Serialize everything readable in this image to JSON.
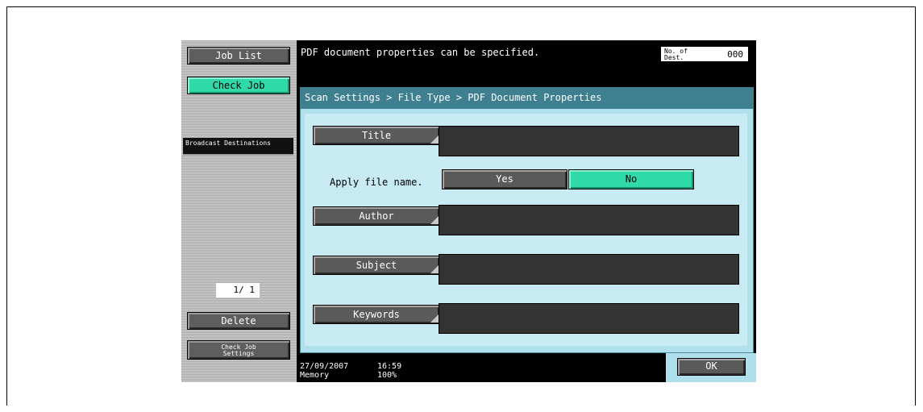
{
  "left_panel": {
    "job_list_label": "Job List",
    "check_job_label": "Check Job",
    "broadcast_label": "Broadcast Destinations",
    "page_count": "1/ 1",
    "delete_label": "Delete",
    "check_job_settings_label": "Check Job Settings"
  },
  "header": {
    "message": "PDF document properties can be specified.",
    "dest_label": "No. of Dest.",
    "dest_value": "000"
  },
  "dialog": {
    "breadcrumb": "Scan Settings > File Type > PDF Document Properties",
    "title_label": "Title",
    "apply_label": "Apply file name.",
    "yes_label": "Yes",
    "no_label": "No",
    "author_label": "Author",
    "subject_label": "Subject",
    "keywords_label": "Keywords",
    "ok_label": "OK"
  },
  "status": {
    "date": "27/09/2007",
    "time": "16:59",
    "memory_label": "Memory",
    "memory_value": "100%"
  },
  "colors": {
    "accent_green": "#2fd9a8",
    "title_bar": "#3e7f90",
    "dialog_bg": "#b0e0ec"
  }
}
